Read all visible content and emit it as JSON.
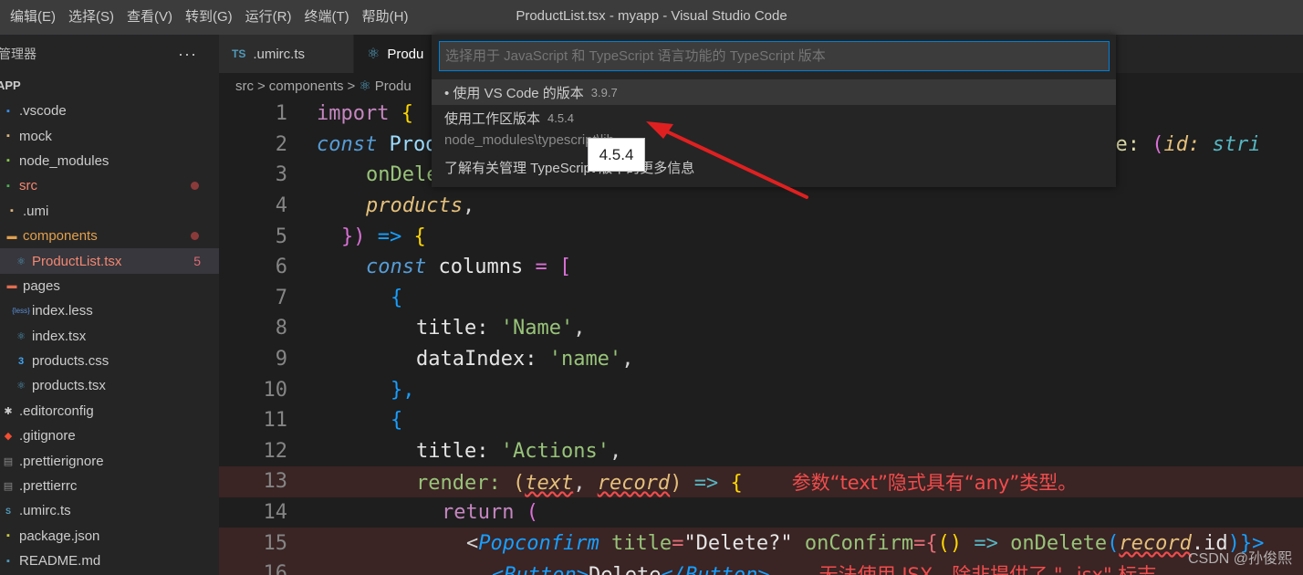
{
  "menu": [
    "编辑(E)",
    "选择(S)",
    "查看(V)",
    "转到(G)",
    "运行(R)",
    "终端(T)",
    "帮助(H)"
  ],
  "window_title": "ProductList.tsx - myapp - Visual Studio Code",
  "explorer": {
    "title": "管理器",
    "more": "···",
    "project": "APP",
    "items": [
      {
        "label": ".vscode",
        "icon": "folder-vscode-icon"
      },
      {
        "label": "mock",
        "icon": "folder-icon"
      },
      {
        "label": "node_modules",
        "icon": "folder-node-icon"
      },
      {
        "label": "src",
        "icon": "folder-src-icon",
        "status": "error"
      },
      {
        "label": ".umi",
        "icon": "folder-icon"
      },
      {
        "label": "components",
        "icon": "folder-open-icon",
        "status": "error"
      },
      {
        "label": "ProductList.tsx",
        "icon": "react-icon",
        "badge": "5"
      },
      {
        "label": "pages",
        "icon": "folder-pages-icon"
      },
      {
        "label": "index.less",
        "icon": "less-icon"
      },
      {
        "label": "index.tsx",
        "icon": "react-icon"
      },
      {
        "label": "products.css",
        "icon": "css-icon"
      },
      {
        "label": "products.tsx",
        "icon": "react-icon"
      },
      {
        "label": ".editorconfig",
        "icon": "editorconfig-icon"
      },
      {
        "label": ".gitignore",
        "icon": "git-icon"
      },
      {
        "label": ".prettierignore",
        "icon": "file-icon"
      },
      {
        "label": ".prettierrc",
        "icon": "file-icon"
      },
      {
        "label": ".umirc.ts",
        "icon": "ts-icon"
      },
      {
        "label": "package.json",
        "icon": "json-icon"
      },
      {
        "label": "README.md",
        "icon": "markdown-icon"
      }
    ]
  },
  "tabs": [
    {
      "label": ".umirc.ts",
      "icon": "TS"
    },
    {
      "label": "Produ",
      "icon": "react"
    }
  ],
  "breadcrumb": [
    "src",
    ">",
    "components",
    ">",
    "Produ"
  ],
  "line_numbers": [
    "1",
    "2",
    "3",
    "4",
    "5",
    "6",
    "7",
    "8",
    "9",
    "10",
    "11",
    "12",
    "13",
    "14",
    "15",
    "16"
  ],
  "code": {
    "l1_import": "import",
    "l1_brace": "{",
    "l2_const": "const",
    "l2_name": "Prod",
    "l2_delete": "elete:",
    "l2_paren": "(",
    "l2_id": "id:",
    "l2_type": "stri",
    "l3": "onDele",
    "l4": "products",
    "l4_comma": ",",
    "l5_close": "})",
    "l5_arrow": "=>",
    "l5_brace": "{",
    "l6_const": "const",
    "l6_var": "columns",
    "l6_eq": "=",
    "l6_br": "[",
    "l7": "{",
    "l8_key": "title:",
    "l8_val": "'Name'",
    "l8_comma": ",",
    "l9_key": "dataIndex:",
    "l9_val": "'name'",
    "l9_comma": ",",
    "l10": "},",
    "l11": "{",
    "l12_key": "title:",
    "l12_val": "'Actions'",
    "l12_comma": ",",
    "l13_key": "render:",
    "l13_p1": "(",
    "l13_text": "text",
    "l13_comma": ",",
    "l13_record": "record",
    "l13_p2": ")",
    "l13_arrow": "=>",
    "l13_brace": "{",
    "l13_error": "参数“text”隐式具有“any”类型。",
    "l14_return": "return",
    "l14_paren": "(",
    "l15_lt": "<",
    "l15_tag": "Popconfirm",
    "l15_attr": "title",
    "l15_eq": "=",
    "l15_val": "\"Delete?\"",
    "l15_attr2": "onConfirm",
    "l15_eq2": "={",
    "l15_fn": "()",
    "l15_arrow": "=>",
    "l15_call": "onDelete",
    "l15_p": "(",
    "l15_rec": "record",
    "l15_id": ".id",
    "l15_end": ")}>",
    "l16_open": "<Button>",
    "l16_text": "Delete",
    "l16_close": "</Button>",
    "l16_error": "无法使用 JSX，除非提供了 \"--jsx\" 标志"
  },
  "quickpick": {
    "placeholder": "选择用于 JavaScript 和 TypeScript 语言功能的 TypeScript 版本",
    "items": [
      {
        "label": "• 使用 VS Code 的版本",
        "desc": "3.9.7"
      },
      {
        "label": "使用工作区版本",
        "desc": "4.5.4"
      },
      {
        "label": "node_modules\\typescript\\lib",
        "desc": ""
      },
      {
        "label": "了解有关管理 TypeScript 版本的更多信息",
        "desc": ""
      }
    ]
  },
  "tooltip": "4.5.4",
  "watermark": "CSDN @孙俊熙",
  "colors": {
    "arrow": "#e02020",
    "accent": "#007fd4"
  }
}
